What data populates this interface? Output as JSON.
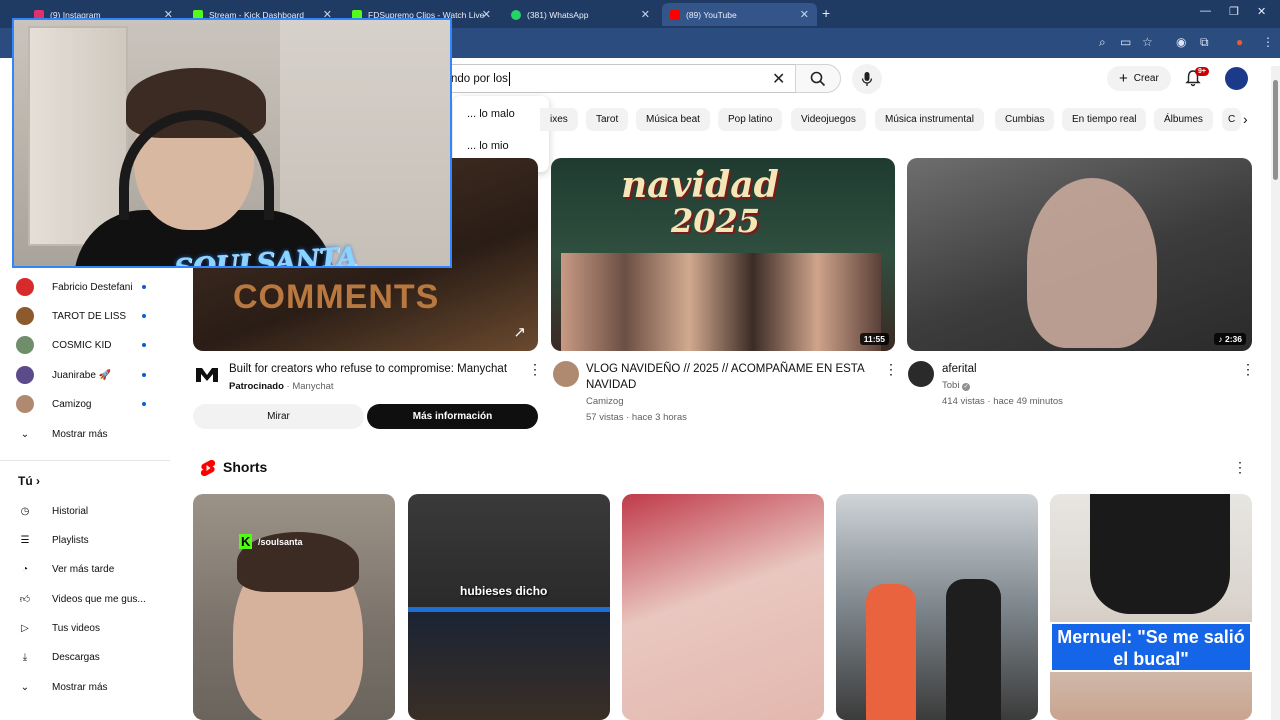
{
  "browser": {
    "tabs": [
      {
        "label": "(9) Instagram",
        "color": "#e1306c"
      },
      {
        "label": "Stream - Kick Dashboard",
        "color": "#53fc18"
      },
      {
        "label": "FDSupremo Clips - Watch Live",
        "color": "#53fc18"
      },
      {
        "label": "(381) WhatsApp",
        "color": "#25d366"
      },
      {
        "label": "(89) YouTube",
        "color": "#ff0000"
      }
    ]
  },
  "overlay": {
    "brand_text": "SOULSANTA"
  },
  "search": {
    "value": "ndo por los"
  },
  "suggestions": [
    "... lo malo",
    "... lo mio"
  ],
  "header": {
    "create_label": "Crear",
    "notif_count": "9+"
  },
  "chips": [
    "ixes",
    "Tarot",
    "Música beat",
    "Pop latino",
    "Videojuegos",
    "Música instrumental",
    "Cumbias",
    "En tiempo real",
    "Álbumes",
    "C"
  ],
  "sidebar": {
    "subscriptions": [
      {
        "name": "Fabricio Destefani",
        "color": "#d72b2b"
      },
      {
        "name": "TAROT DE LISS",
        "color": "#8c5a2b"
      },
      {
        "name": "COSMIC KID",
        "color": "#6f8f6a"
      },
      {
        "name": "Juanirabe 🚀",
        "color": "#5b4b8a"
      },
      {
        "name": "Camizog",
        "color": "#b08a70"
      }
    ],
    "show_more": "Mostrar más",
    "you_label": "Tú",
    "you_items": [
      "Historial",
      "Playlists",
      "Ver más tarde",
      "Videos que me gus...",
      "Tus videos",
      "Descargas"
    ],
    "show_more_2": "Mostrar más"
  },
  "videos": [
    {
      "title": "Built for creators who refuse to compromise: Manychat",
      "sponsored": "Patrocinado",
      "channel": "Manychat",
      "thumb_text": "COMMENTS",
      "btn_watch": "Mirar",
      "btn_more": "Más información"
    },
    {
      "title": "VLOG NAVIDEÑO // 2025 // ACOMPAÑAME EN ESTA NAVIDAD",
      "channel": "Camizog",
      "stats": "57 vistas · hace 3 horas",
      "duration": "11:55",
      "thumb_text_1": "navidad",
      "thumb_text_2": "2025"
    },
    {
      "title": "aferital",
      "channel": "Tobi",
      "stats": "414 vistas · hace 49 minutos",
      "duration": "2:36"
    }
  ],
  "shorts": {
    "title": "Shorts",
    "items": [
      {
        "overlay": "/soulsanta"
      },
      {
        "overlay": "hubieses dicho"
      },
      {
        "overlay": ""
      },
      {
        "overlay": ""
      },
      {
        "overlay": "Mernuel: \"Se me salió el bucal\""
      }
    ]
  }
}
